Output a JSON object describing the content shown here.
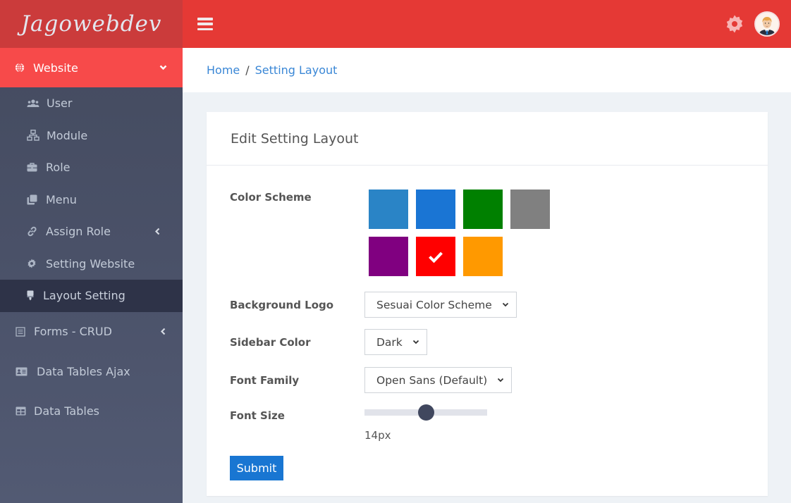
{
  "app": {
    "logo_text": "Jagowebdev"
  },
  "sidebar": {
    "parent": {
      "label": "Website",
      "icon": "globe-icon"
    },
    "sub_items": [
      {
        "label": "User",
        "icon": "users-icon"
      },
      {
        "label": "Module",
        "icon": "sitemap-icon"
      },
      {
        "label": "Role",
        "icon": "briefcase-icon"
      },
      {
        "label": "Menu",
        "icon": "clone-icon"
      },
      {
        "label": "Assign Role",
        "icon": "link-icon",
        "has_submenu": true
      },
      {
        "label": "Setting Website",
        "icon": "cog-icon"
      },
      {
        "label": "Layout Setting",
        "icon": "paint-brush-icon",
        "active": true
      }
    ],
    "top_items": [
      {
        "label": "Forms - CRUD",
        "icon": "form-icon",
        "has_submenu": true
      },
      {
        "label": "Data Tables Ajax",
        "icon": "id-card-icon"
      },
      {
        "label": "Data Tables",
        "icon": "table-icon"
      }
    ]
  },
  "topbar": {
    "menu_icon": "hamburger-icon",
    "settings_icon": "gear-icon",
    "avatar_icon": "user-avatar"
  },
  "breadcrumb": {
    "home": "Home",
    "separator": "/",
    "current": "Setting Layout"
  },
  "card": {
    "title": "Edit Setting Layout",
    "color_scheme": {
      "label": "Color Scheme",
      "swatches": [
        {
          "name": "blue-light",
          "color": "#2a84c6"
        },
        {
          "name": "blue",
          "color": "#1a75d4"
        },
        {
          "name": "green",
          "color": "#008000"
        },
        {
          "name": "gray",
          "color": "#808080"
        },
        {
          "name": "purple",
          "color": "#800080"
        },
        {
          "name": "red",
          "color": "#ff0000",
          "selected": true
        },
        {
          "name": "orange",
          "color": "#ff9900"
        }
      ]
    },
    "background_logo": {
      "label": "Background Logo",
      "value": "Sesuai Color Scheme"
    },
    "sidebar_color": {
      "label": "Sidebar Color",
      "value": "Dark"
    },
    "font_family": {
      "label": "Font Family",
      "value": "Open Sans (Default)"
    },
    "font_size": {
      "label": "Font Size",
      "value_text": "14px",
      "position_fraction": 0.5
    },
    "submit_label": "Submit"
  },
  "colors": {
    "accent": "#e53935",
    "sidebar_active_bg": "#f74a4a",
    "logo_bg": "#cb3b3b",
    "link": "#3a87d6",
    "button": "#1976d2"
  }
}
